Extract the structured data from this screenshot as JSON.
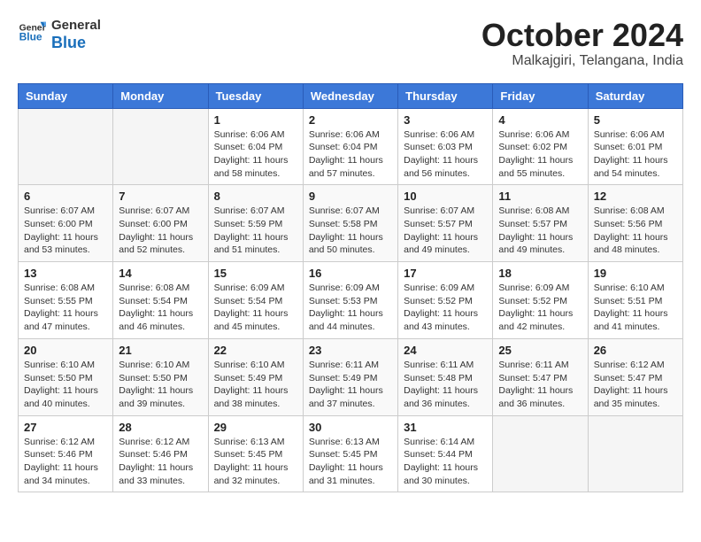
{
  "header": {
    "logo_general": "General",
    "logo_blue": "Blue",
    "month": "October 2024",
    "location": "Malkajgiri, Telangana, India"
  },
  "days_of_week": [
    "Sunday",
    "Monday",
    "Tuesday",
    "Wednesday",
    "Thursday",
    "Friday",
    "Saturday"
  ],
  "weeks": [
    [
      {
        "day": "",
        "info": ""
      },
      {
        "day": "",
        "info": ""
      },
      {
        "day": "1",
        "info": "Sunrise: 6:06 AM\nSunset: 6:04 PM\nDaylight: 11 hours and 58 minutes."
      },
      {
        "day": "2",
        "info": "Sunrise: 6:06 AM\nSunset: 6:04 PM\nDaylight: 11 hours and 57 minutes."
      },
      {
        "day": "3",
        "info": "Sunrise: 6:06 AM\nSunset: 6:03 PM\nDaylight: 11 hours and 56 minutes."
      },
      {
        "day": "4",
        "info": "Sunrise: 6:06 AM\nSunset: 6:02 PM\nDaylight: 11 hours and 55 minutes."
      },
      {
        "day": "5",
        "info": "Sunrise: 6:06 AM\nSunset: 6:01 PM\nDaylight: 11 hours and 54 minutes."
      }
    ],
    [
      {
        "day": "6",
        "info": "Sunrise: 6:07 AM\nSunset: 6:00 PM\nDaylight: 11 hours and 53 minutes."
      },
      {
        "day": "7",
        "info": "Sunrise: 6:07 AM\nSunset: 6:00 PM\nDaylight: 11 hours and 52 minutes."
      },
      {
        "day": "8",
        "info": "Sunrise: 6:07 AM\nSunset: 5:59 PM\nDaylight: 11 hours and 51 minutes."
      },
      {
        "day": "9",
        "info": "Sunrise: 6:07 AM\nSunset: 5:58 PM\nDaylight: 11 hours and 50 minutes."
      },
      {
        "day": "10",
        "info": "Sunrise: 6:07 AM\nSunset: 5:57 PM\nDaylight: 11 hours and 49 minutes."
      },
      {
        "day": "11",
        "info": "Sunrise: 6:08 AM\nSunset: 5:57 PM\nDaylight: 11 hours and 49 minutes."
      },
      {
        "day": "12",
        "info": "Sunrise: 6:08 AM\nSunset: 5:56 PM\nDaylight: 11 hours and 48 minutes."
      }
    ],
    [
      {
        "day": "13",
        "info": "Sunrise: 6:08 AM\nSunset: 5:55 PM\nDaylight: 11 hours and 47 minutes."
      },
      {
        "day": "14",
        "info": "Sunrise: 6:08 AM\nSunset: 5:54 PM\nDaylight: 11 hours and 46 minutes."
      },
      {
        "day": "15",
        "info": "Sunrise: 6:09 AM\nSunset: 5:54 PM\nDaylight: 11 hours and 45 minutes."
      },
      {
        "day": "16",
        "info": "Sunrise: 6:09 AM\nSunset: 5:53 PM\nDaylight: 11 hours and 44 minutes."
      },
      {
        "day": "17",
        "info": "Sunrise: 6:09 AM\nSunset: 5:52 PM\nDaylight: 11 hours and 43 minutes."
      },
      {
        "day": "18",
        "info": "Sunrise: 6:09 AM\nSunset: 5:52 PM\nDaylight: 11 hours and 42 minutes."
      },
      {
        "day": "19",
        "info": "Sunrise: 6:10 AM\nSunset: 5:51 PM\nDaylight: 11 hours and 41 minutes."
      }
    ],
    [
      {
        "day": "20",
        "info": "Sunrise: 6:10 AM\nSunset: 5:50 PM\nDaylight: 11 hours and 40 minutes."
      },
      {
        "day": "21",
        "info": "Sunrise: 6:10 AM\nSunset: 5:50 PM\nDaylight: 11 hours and 39 minutes."
      },
      {
        "day": "22",
        "info": "Sunrise: 6:10 AM\nSunset: 5:49 PM\nDaylight: 11 hours and 38 minutes."
      },
      {
        "day": "23",
        "info": "Sunrise: 6:11 AM\nSunset: 5:49 PM\nDaylight: 11 hours and 37 minutes."
      },
      {
        "day": "24",
        "info": "Sunrise: 6:11 AM\nSunset: 5:48 PM\nDaylight: 11 hours and 36 minutes."
      },
      {
        "day": "25",
        "info": "Sunrise: 6:11 AM\nSunset: 5:47 PM\nDaylight: 11 hours and 36 minutes."
      },
      {
        "day": "26",
        "info": "Sunrise: 6:12 AM\nSunset: 5:47 PM\nDaylight: 11 hours and 35 minutes."
      }
    ],
    [
      {
        "day": "27",
        "info": "Sunrise: 6:12 AM\nSunset: 5:46 PM\nDaylight: 11 hours and 34 minutes."
      },
      {
        "day": "28",
        "info": "Sunrise: 6:12 AM\nSunset: 5:46 PM\nDaylight: 11 hours and 33 minutes."
      },
      {
        "day": "29",
        "info": "Sunrise: 6:13 AM\nSunset: 5:45 PM\nDaylight: 11 hours and 32 minutes."
      },
      {
        "day": "30",
        "info": "Sunrise: 6:13 AM\nSunset: 5:45 PM\nDaylight: 11 hours and 31 minutes."
      },
      {
        "day": "31",
        "info": "Sunrise: 6:14 AM\nSunset: 5:44 PM\nDaylight: 11 hours and 30 minutes."
      },
      {
        "day": "",
        "info": ""
      },
      {
        "day": "",
        "info": ""
      }
    ]
  ]
}
